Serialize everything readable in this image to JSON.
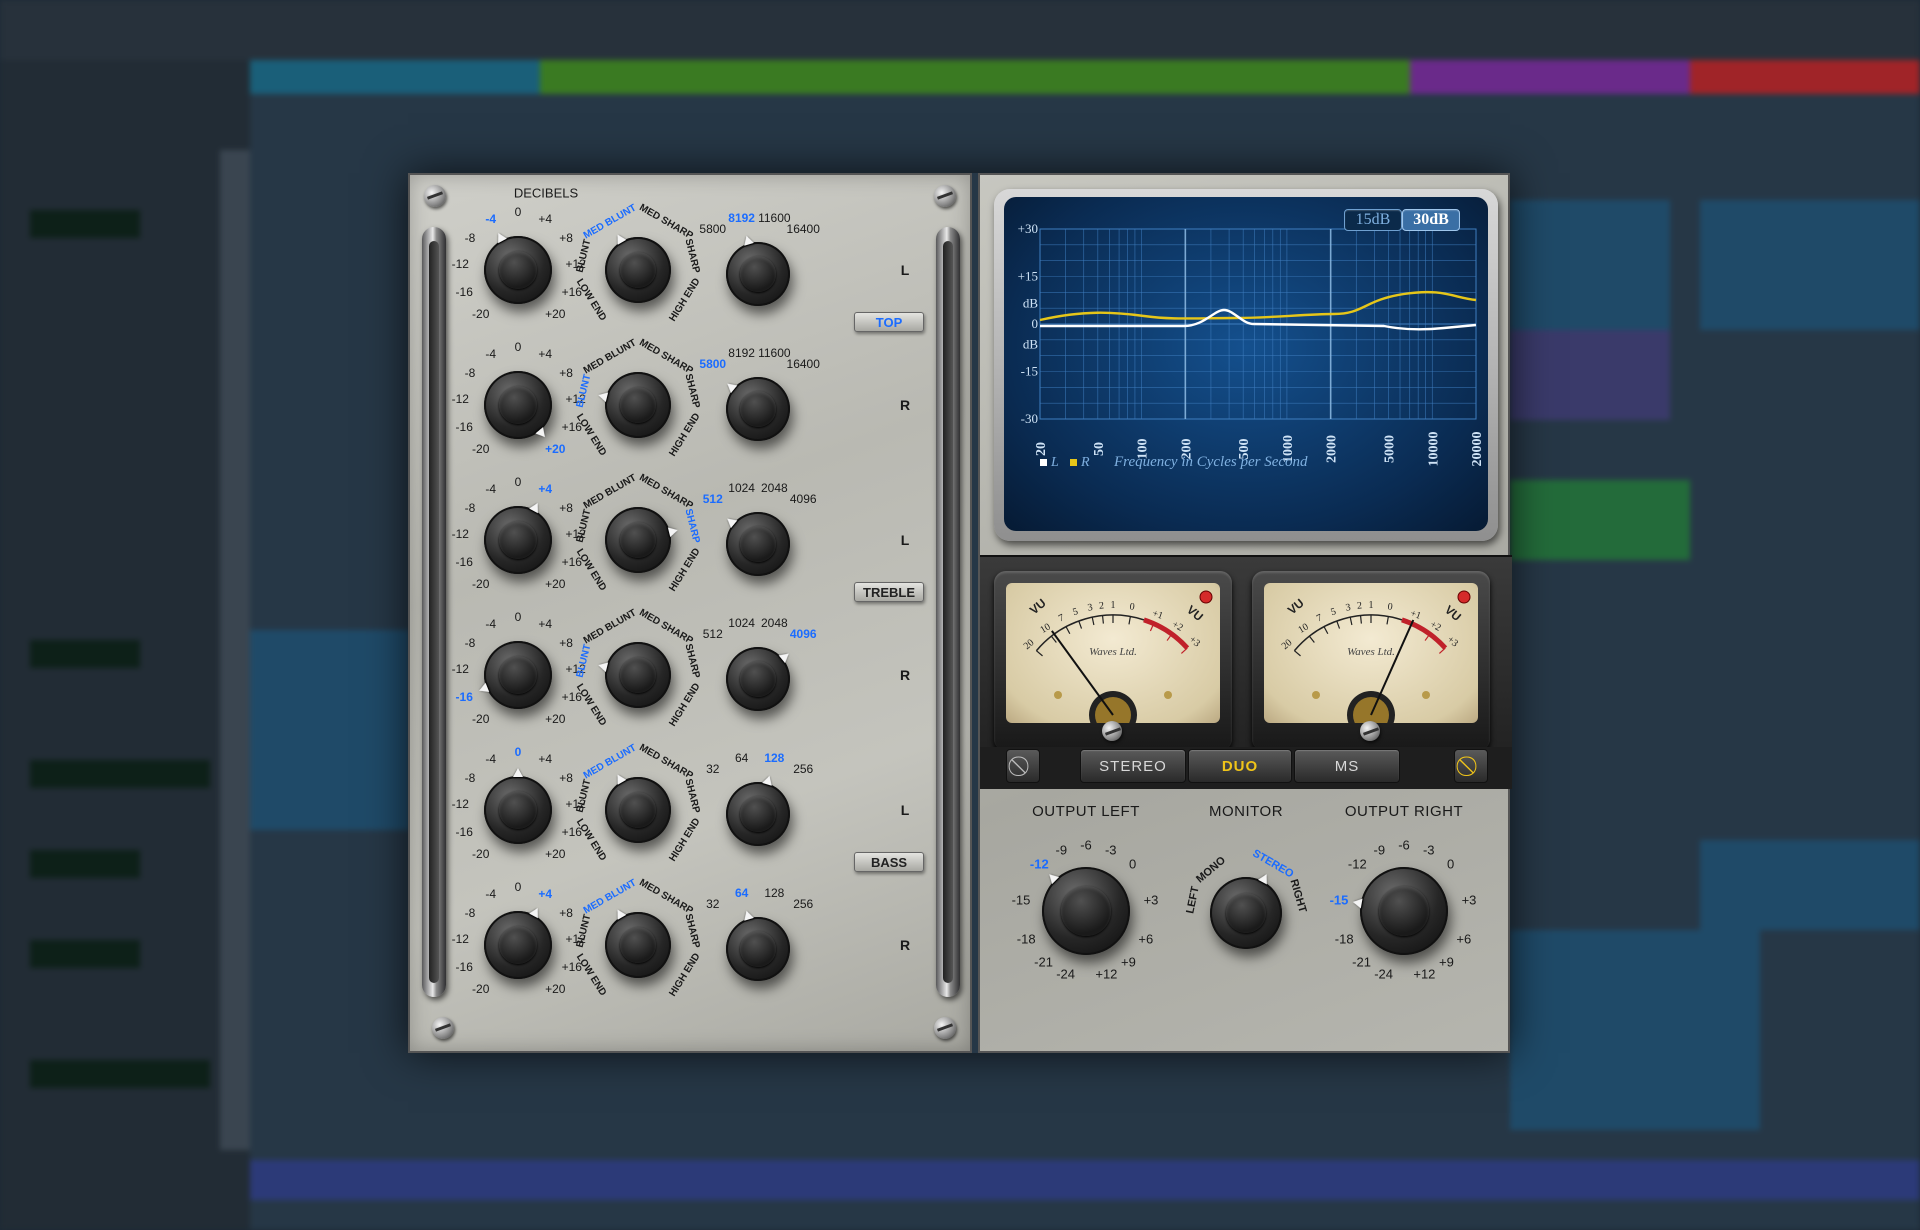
{
  "eq": {
    "title": "DECIBELS",
    "bands": [
      {
        "gain_labels": [
          "0",
          "+4",
          "+8",
          "+12",
          "+16",
          "+20",
          "-20",
          "-16",
          "-12",
          "-8",
          "-4"
        ],
        "gain_selected": "-4",
        "shape_selected": "MED BLUNT",
        "freq_labels": [
          "5800",
          "8192",
          "11600",
          "16400"
        ],
        "freq_selected": "8192",
        "channel": "L"
      },
      {
        "gain_labels": [
          "0",
          "+4",
          "+8",
          "+12",
          "+16",
          "+20",
          "-20",
          "-16",
          "-12",
          "-8",
          "-4"
        ],
        "gain_selected": "+20",
        "shape_selected": "BLUNT",
        "freq_labels": [
          "5800",
          "8192",
          "11600",
          "16400"
        ],
        "freq_selected": "5800",
        "channel": "R"
      },
      {
        "gain_labels": [
          "0",
          "+4",
          "+8",
          "+12",
          "+16",
          "+20",
          "-20",
          "-16",
          "-12",
          "-8",
          "-4"
        ],
        "gain_selected": "+4",
        "shape_selected": "SHARP",
        "freq_labels": [
          "512",
          "1024",
          "2048",
          "4096"
        ],
        "freq_selected": "512",
        "channel": "L"
      },
      {
        "gain_labels": [
          "0",
          "+4",
          "+8",
          "+12",
          "+16",
          "+20",
          "-20",
          "-16",
          "-12",
          "-8",
          "-4"
        ],
        "gain_selected": "-16",
        "shape_selected": "BLUNT",
        "freq_labels": [
          "512",
          "1024",
          "2048",
          "4096"
        ],
        "freq_selected": "4096",
        "channel": "R"
      },
      {
        "gain_labels": [
          "0",
          "+4",
          "+8",
          "+12",
          "+16",
          "+20",
          "-20",
          "-16",
          "-12",
          "-8",
          "-4"
        ],
        "gain_selected": "0",
        "shape_selected": "MED BLUNT",
        "freq_labels": [
          "32",
          "64",
          "128",
          "256"
        ],
        "freq_selected": "128",
        "channel": "L"
      },
      {
        "gain_labels": [
          "0",
          "+4",
          "+8",
          "+12",
          "+16",
          "+20",
          "-20",
          "-16",
          "-12",
          "-8",
          "-4"
        ],
        "gain_selected": "+4",
        "shape_selected": "MED BLUNT",
        "freq_labels": [
          "32",
          "64",
          "128",
          "256"
        ],
        "freq_selected": "64",
        "channel": "R"
      }
    ],
    "shape_labels": [
      "LOW END",
      "BLUNT",
      "MED BLUNT",
      "MED SHARP",
      "SHARP",
      "HIGH END"
    ],
    "sections": [
      {
        "label": "TOP",
        "active": true
      },
      {
        "label": "TREBLE",
        "active": false
      },
      {
        "label": "BASS",
        "active": false
      }
    ]
  },
  "graph": {
    "range_buttons": [
      {
        "label": "15dB",
        "active": false
      },
      {
        "label": "30dB",
        "active": true
      }
    ],
    "y_labels": [
      "+30",
      "+15",
      "dB",
      "0",
      "dB",
      "-15",
      "-30"
    ],
    "x_labels": [
      "20",
      "50",
      "100",
      "200",
      "500",
      "1000",
      "2000",
      "5000",
      "10000",
      "20000"
    ],
    "legend_l": "L",
    "legend_r": "R",
    "caption": "Frequency in Cycles per Second",
    "colors": {
      "left": "#ffffff",
      "right": "#e6c619",
      "grid": "#3f7ec0"
    }
  },
  "meters": {
    "brand": "Waves Ltd.",
    "scale": [
      "20",
      "10",
      "7",
      "5",
      "3",
      "2",
      "1",
      "0",
      "+1",
      "+2",
      "+3"
    ],
    "unit": "VU"
  },
  "modes": {
    "buttons": [
      {
        "label": "STEREO",
        "active": false
      },
      {
        "label": "DUO",
        "active": true
      },
      {
        "label": "MS",
        "active": false
      }
    ]
  },
  "outputs": {
    "left": {
      "title": "OUTPUT LEFT",
      "labels": [
        "-6",
        "-3",
        "0",
        "+3",
        "+6",
        "+9",
        "+12",
        "-24",
        "-21",
        "-18",
        "-15",
        "-12",
        "-9"
      ],
      "selected": "-12"
    },
    "monitor": {
      "title": "MONITOR",
      "labels": [
        "LEFT",
        "MONO",
        "STEREO",
        "RIGHT"
      ],
      "selected": "STEREO"
    },
    "right": {
      "title": "OUTPUT RIGHT",
      "labels": [
        "-6",
        "-3",
        "0",
        "+3",
        "+6",
        "+9",
        "+12",
        "-24",
        "-21",
        "-18",
        "-15",
        "-12",
        "-9"
      ],
      "selected": "-15"
    }
  }
}
